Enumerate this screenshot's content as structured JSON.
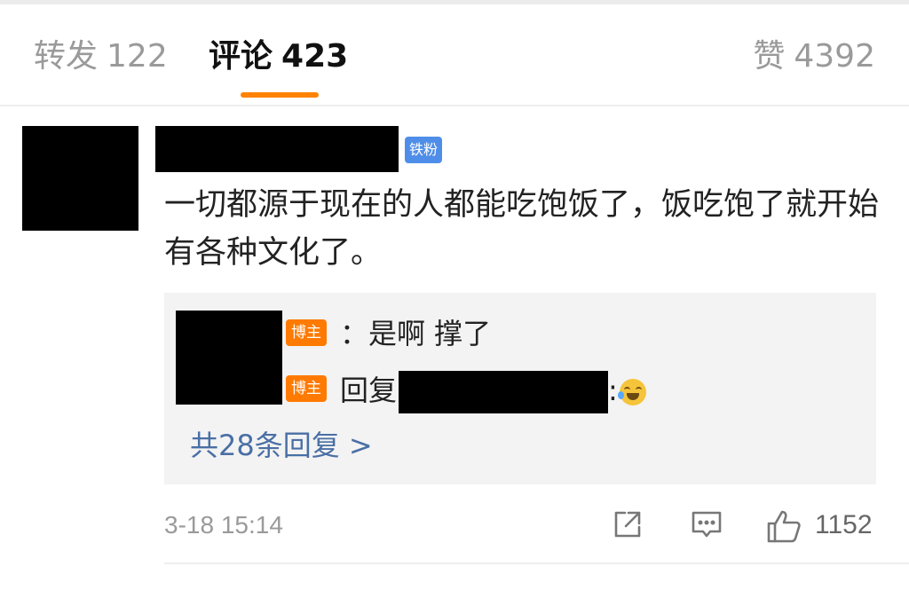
{
  "tabs": {
    "repost": {
      "label": "转发",
      "count": "122"
    },
    "comments": {
      "label": "评论",
      "count": "423"
    },
    "likes": {
      "label": "赞",
      "count": "4392"
    }
  },
  "comment": {
    "badge": "铁粉",
    "text": "一切都源于现在的人都能吃饱饭了，饭吃饱了就开始有各种文化了。",
    "replies": [
      {
        "badge": "博主",
        "text": "：是啊 撑了"
      },
      {
        "badge": "博主",
        "prefix": "回复",
        "suffix": ":"
      }
    ],
    "more_replies": "共28条回复 >",
    "timestamp": "3-18 15:14",
    "like_count": "1152"
  },
  "icons": {
    "share": "share-icon",
    "comment": "comment-icon",
    "like": "thumbs-up-icon",
    "emoji": "laugh-cry-emoji"
  },
  "colors": {
    "accent": "#ff8200",
    "fan_badge": "#4f8ee8",
    "host_badge": "#ff7a00",
    "link": "#4a6fa5"
  }
}
